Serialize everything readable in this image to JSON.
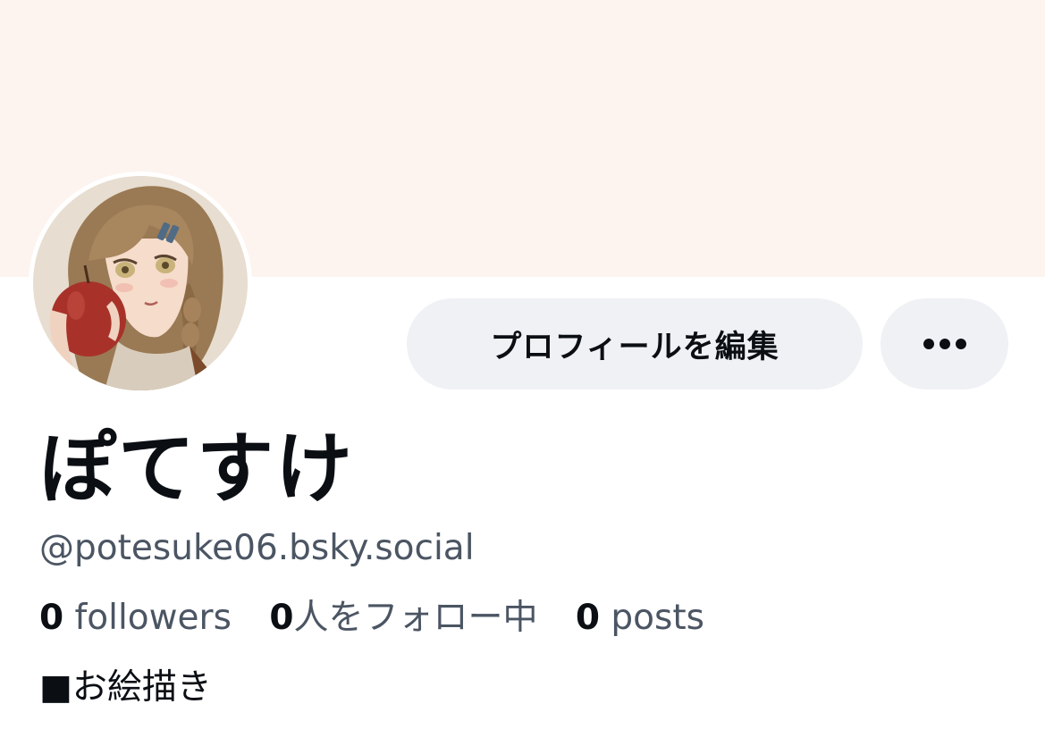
{
  "profile": {
    "display_name": "ぽてすけ",
    "handle": "@potesuke06.bsky.social",
    "bio": "■お絵描き",
    "banner_color": "#fdf4ef",
    "avatar_icon": "illustrated-girl-holding-apple"
  },
  "actions": {
    "edit_profile_label": "プロフィールを編集",
    "more_icon": "ellipsis-icon"
  },
  "stats": {
    "followers_count": "0",
    "followers_label": " followers",
    "following_count": "0",
    "following_label": "人をフォロー中",
    "posts_count": "0",
    "posts_label": " posts"
  }
}
